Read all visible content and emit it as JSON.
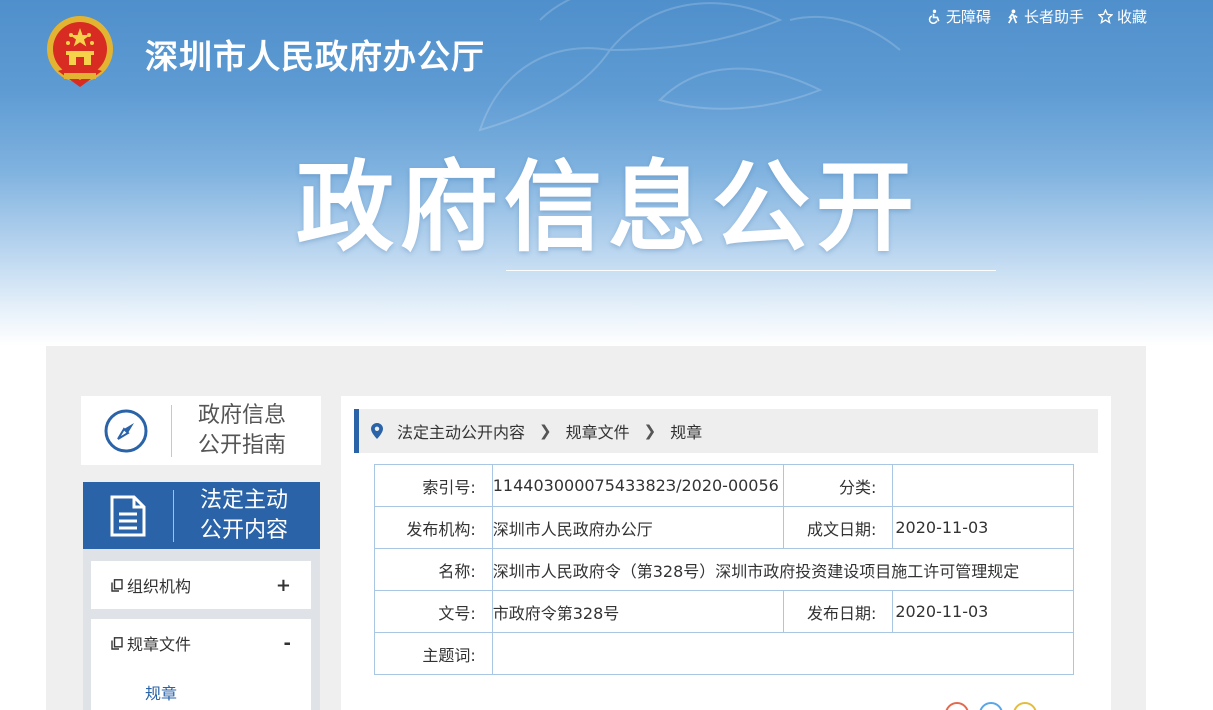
{
  "header": {
    "site_title": "深圳市人民政府办公厅",
    "hero_title": "政府信息公开",
    "links": [
      {
        "label": "无障碍",
        "icon": "accessibility-icon"
      },
      {
        "label": "长者助手",
        "icon": "elder-assist-icon"
      },
      {
        "label": "收藏",
        "icon": "star-icon"
      }
    ]
  },
  "sidebar": {
    "guide_label": "政府信息公开指南",
    "guide_line1": "政府信息",
    "guide_line2": "公开指南",
    "active_line1": "法定主动",
    "active_line2": "公开内容",
    "items": [
      {
        "label": "组织机构",
        "sign": "+"
      },
      {
        "label": "规章文件",
        "sign": "-"
      }
    ],
    "sub_item": "规章"
  },
  "breadcrumb": [
    "法定主动公开内容",
    "规章文件",
    "规章"
  ],
  "doc_info": {
    "index_label": "索引号:",
    "index_value": "11440300007543382З/2020-00056",
    "category_label": "分类:",
    "category_value": "",
    "publisher_label": "发布机构:",
    "publisher_value": "深圳市人民政府办公厅",
    "created_label": "成文日期:",
    "created_value": "2020-11-03",
    "name_label": "名称:",
    "name_value": "深圳市人民政府令（第328号）深圳市政府投资建设项目施工许可管理规定",
    "docno_label": "文号:",
    "docno_value": "市政府令第328号",
    "published_label": "发布日期:",
    "published_value": "2020-11-03",
    "keywords_label": "主题词:",
    "keywords_value": ""
  },
  "colors": {
    "accent": "#2a63a8",
    "table_border": "#a9c7e2",
    "panel_bg": "#efefef"
  }
}
